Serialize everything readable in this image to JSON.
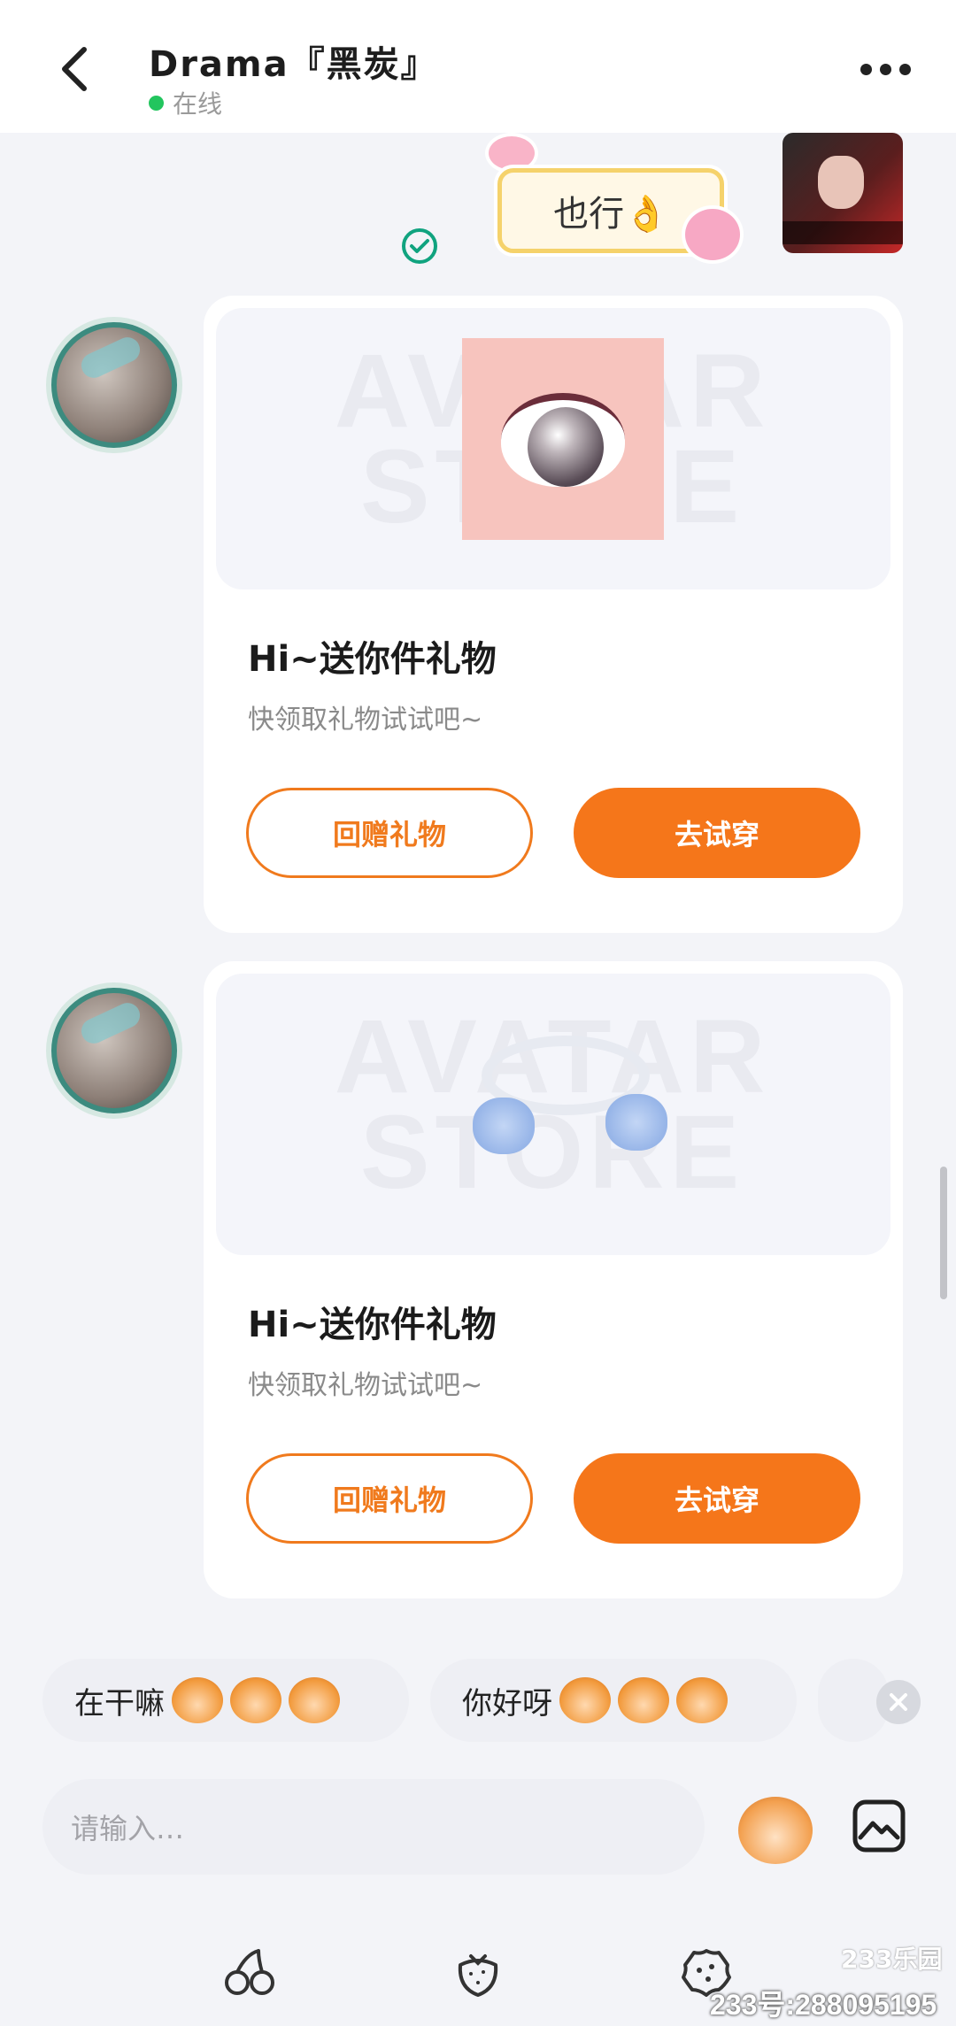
{
  "header": {
    "title": "Drama『黑炭』",
    "status": "在线",
    "status_color": "#22c55e"
  },
  "sticker_message": {
    "text": "也行👌"
  },
  "cards": [
    {
      "watermark": "AVATAR STORE",
      "title": "Hi~送你件礼物",
      "subtitle": "快领取礼物试试吧~",
      "return_gift_label": "回赠礼物",
      "try_on_label": "去试穿",
      "item": "eye"
    },
    {
      "watermark": "AVATAR STORE",
      "title": "Hi~送你件礼物",
      "subtitle": "快领取礼物试试吧~",
      "return_gift_label": "回赠礼物",
      "try_on_label": "去试穿",
      "item": "flower-headband"
    }
  ],
  "quick_replies": [
    {
      "label": "在干嘛"
    },
    {
      "label": "你好呀"
    }
  ],
  "input": {
    "placeholder": "请输入…"
  },
  "watermark": {
    "logo": "233乐园",
    "id": "233号:288095195"
  },
  "colors": {
    "accent": "#f5761a",
    "background": "#f3f4f8"
  }
}
